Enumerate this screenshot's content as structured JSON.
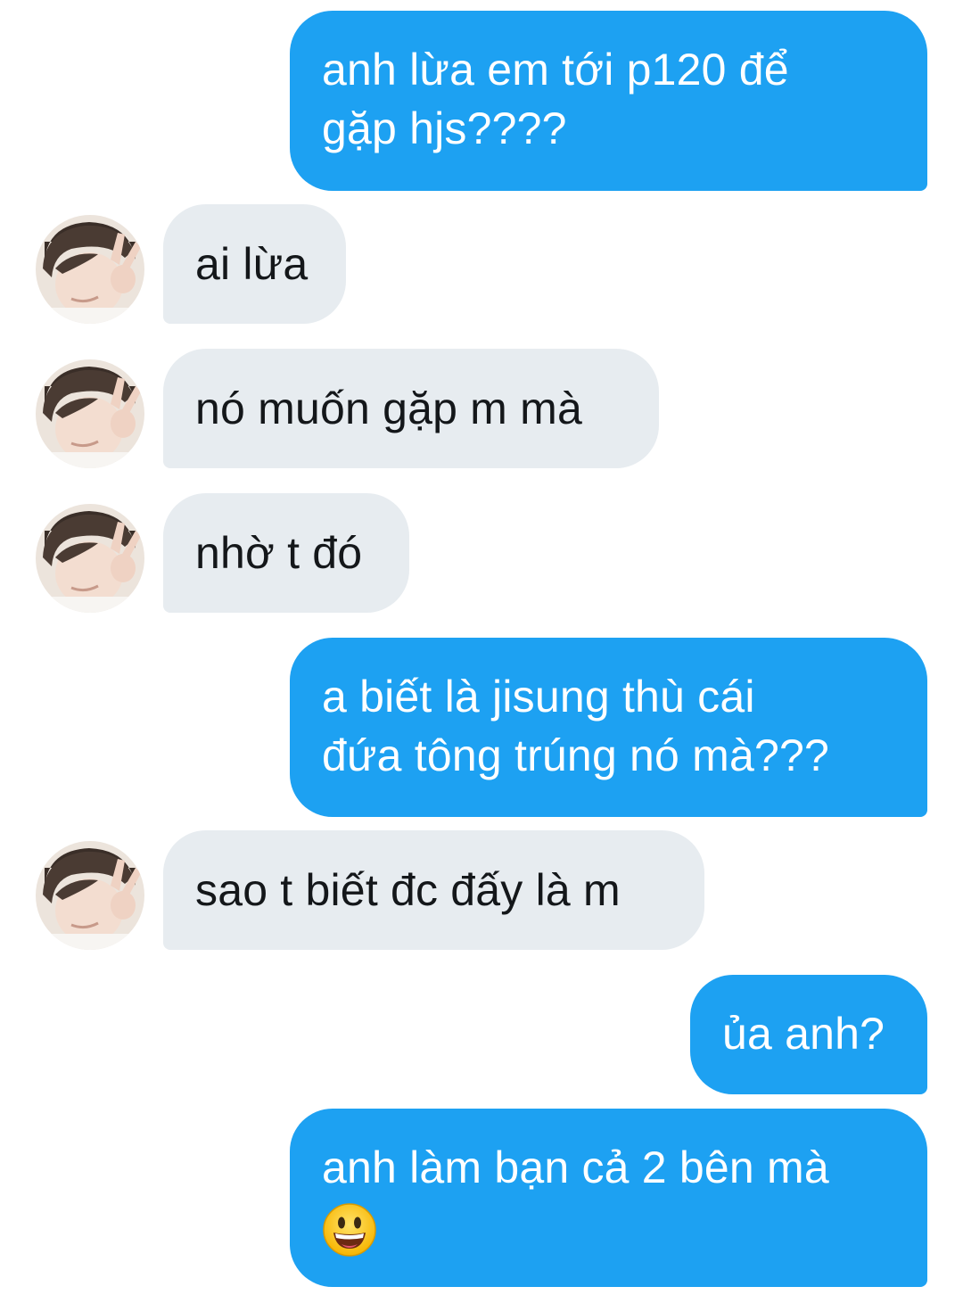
{
  "conversation": {
    "messages": [
      {
        "direction": "outgoing",
        "lines": [
          "anh lừa em tới p120 để",
          "gặp hjs????"
        ]
      },
      {
        "direction": "incoming",
        "lines": [
          "ai lừa"
        ]
      },
      {
        "direction": "incoming",
        "lines": [
          "nó muốn gặp m mà"
        ]
      },
      {
        "direction": "incoming",
        "lines": [
          "nhờ t đó"
        ]
      },
      {
        "direction": "outgoing",
        "lines": [
          "a biết là jisung thù cái",
          "đứa tông trúng nó mà???"
        ]
      },
      {
        "direction": "incoming",
        "lines": [
          "sao t biết đc đấy là m"
        ]
      },
      {
        "direction": "outgoing",
        "lines": [
          "ủa anh?"
        ]
      },
      {
        "direction": "outgoing",
        "lines": [
          "anh làm bạn cả 2 bên mà"
        ],
        "emoji": "grinning-face-emoji"
      }
    ]
  },
  "theme": {
    "outgoing_bubble_color": "#1DA1F2",
    "incoming_bubble_color": "#E7ECF0",
    "incoming_text_color": "#14171A",
    "outgoing_text_color": "#FFFFFF"
  }
}
